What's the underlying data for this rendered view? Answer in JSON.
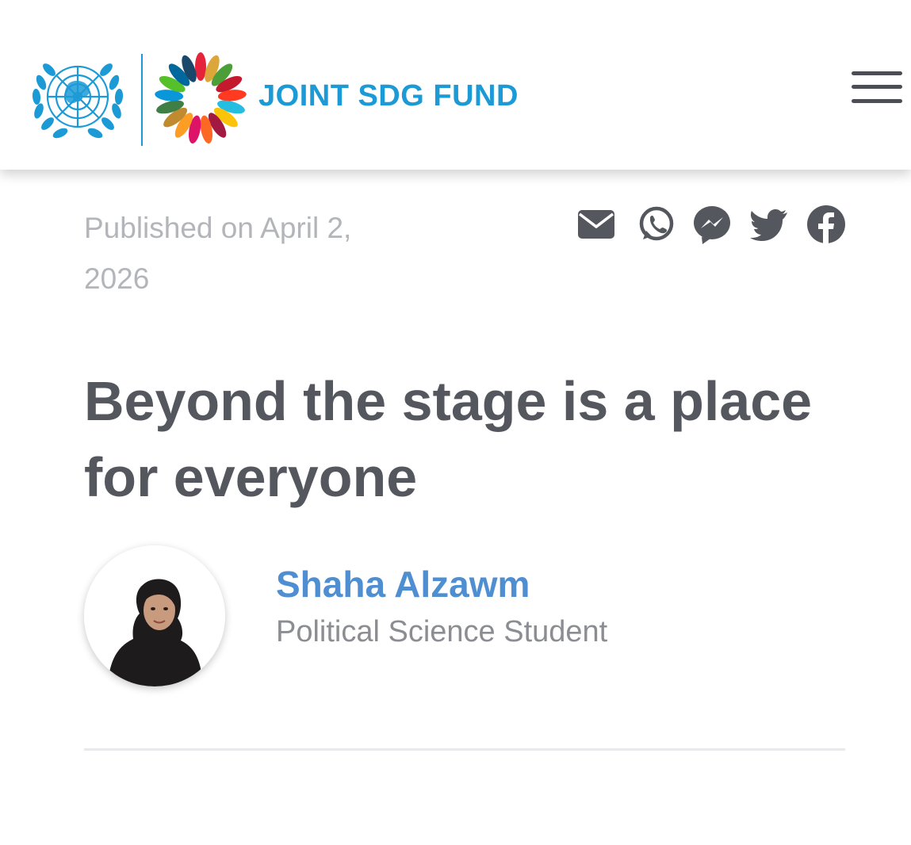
{
  "header": {
    "brand_name": "JOINT SDG FUND",
    "brand_color": "#1c9ad6",
    "un_emblem_icon": "un-emblem-icon",
    "sdg_wheel_icon": "sdg-wheel-icon",
    "menu_icon": "hamburger-menu-icon"
  },
  "article": {
    "published": "Published on April 2, 2026",
    "title": "Beyond the stage is a place for everyone",
    "share_icons": [
      "email-icon",
      "whatsapp-icon",
      "messenger-icon",
      "twitter-icon",
      "facebook-icon"
    ]
  },
  "author": {
    "name": "Shaha Alzawm",
    "role": "Political Science Student",
    "name_color": "#4f8fd1"
  }
}
